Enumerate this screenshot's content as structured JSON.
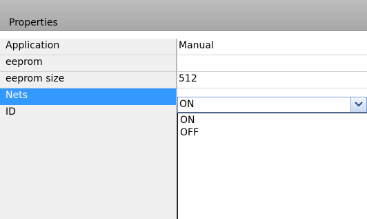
{
  "header": {
    "title": "Properties"
  },
  "rows": [
    {
      "name": "Application",
      "value": "Manual"
    },
    {
      "name": "eeprom",
      "value": ""
    },
    {
      "name": "eeprom size",
      "value": "512"
    },
    {
      "name": "Nets",
      "value": "ON"
    },
    {
      "name": "ID",
      "value": ""
    }
  ],
  "dropdown": {
    "selected": "ON",
    "options": [
      "ON",
      "OFF"
    ],
    "button_icon": "chevron-down-icon"
  },
  "colors": {
    "header_bg": "#a8a8a8",
    "selection": "#3399ff",
    "name_column_bg": "#f0f0f0"
  }
}
